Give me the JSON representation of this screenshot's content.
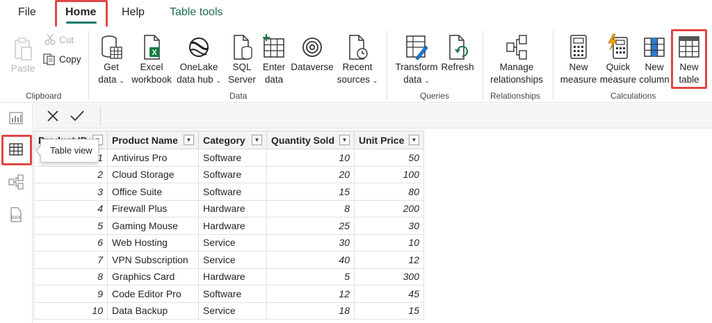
{
  "tabs": {
    "file": "File",
    "home": "Home",
    "help": "Help",
    "table_tools": "Table tools"
  },
  "ribbon": {
    "clipboard": {
      "paste": "Paste",
      "cut": "Cut",
      "copy": "Copy",
      "group_label": "Clipboard"
    },
    "data": {
      "get_data": [
        "Get",
        "data"
      ],
      "excel_workbook": [
        "Excel",
        "workbook"
      ],
      "onelake_data_hub": [
        "OneLake",
        "data hub"
      ],
      "sql_server": [
        "SQL",
        "Server"
      ],
      "enter_data": [
        "Enter",
        "data"
      ],
      "dataverse": "Dataverse",
      "recent_sources": [
        "Recent",
        "sources"
      ],
      "group_label": "Data"
    },
    "queries": {
      "transform_data": [
        "Transform",
        "data"
      ],
      "refresh": "Refresh",
      "group_label": "Queries"
    },
    "relationships": {
      "manage_relationships": [
        "Manage",
        "relationships"
      ],
      "group_label": "Relationships"
    },
    "calculations": {
      "new_measure": [
        "New",
        "measure"
      ],
      "quick_measure": [
        "Quick",
        "measure"
      ],
      "new_column": [
        "New",
        "column"
      ],
      "new_table": [
        "New",
        "table"
      ],
      "group_label": "Calculations"
    }
  },
  "tooltip": "Table view",
  "table": {
    "columns": [
      "Product ID",
      "Product Name",
      "Category",
      "Quantity Sold",
      "Unit Price"
    ],
    "rows": [
      [
        "1",
        "Antivirus Pro",
        "Software",
        "10",
        "50"
      ],
      [
        "2",
        "Cloud Storage",
        "Software",
        "20",
        "100"
      ],
      [
        "3",
        "Office Suite",
        "Software",
        "15",
        "80"
      ],
      [
        "4",
        "Firewall Plus",
        "Hardware",
        "8",
        "200"
      ],
      [
        "5",
        "Gaming Mouse",
        "Hardware",
        "25",
        "30"
      ],
      [
        "6",
        "Web Hosting",
        "Service",
        "30",
        "10"
      ],
      [
        "7",
        "VPN Subscription",
        "Service",
        "40",
        "12"
      ],
      [
        "8",
        "Graphics Card",
        "Hardware",
        "5",
        "300"
      ],
      [
        "9",
        "Code Editor Pro",
        "Software",
        "12",
        "45"
      ],
      [
        "10",
        "Data Backup",
        "Service",
        "18",
        "15"
      ]
    ]
  },
  "colors": {
    "accent": "#117865",
    "highlight": "#e04646",
    "excel_green": "#107c41"
  }
}
